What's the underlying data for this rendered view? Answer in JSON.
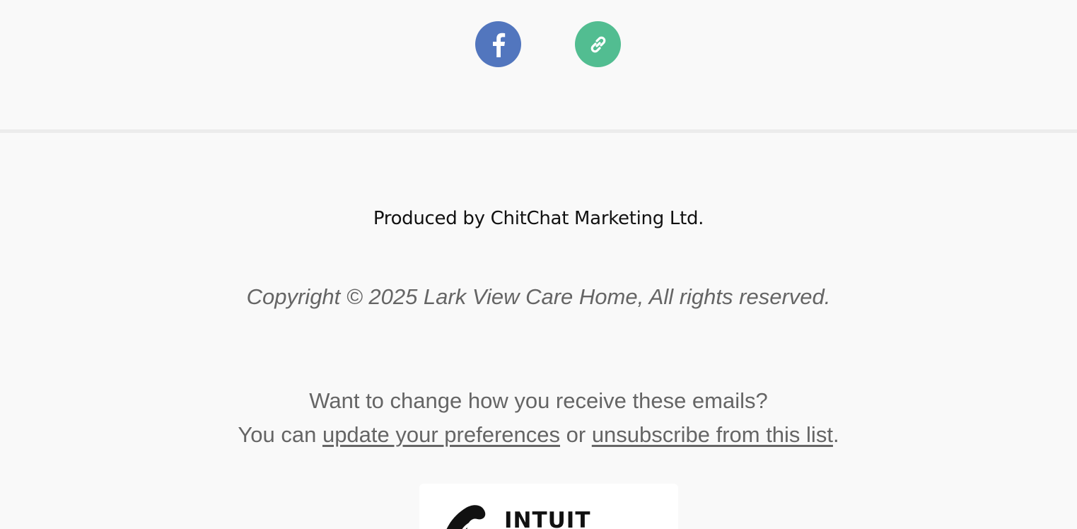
{
  "social": {
    "facebook": {
      "icon": "facebook-icon",
      "color": "#5276be"
    },
    "link": {
      "icon": "link-icon",
      "color": "#52bd91"
    }
  },
  "footer": {
    "produced_by": "Produced by ChitChat Marketing Ltd.",
    "copyright": "Copyright © 2025 Lark View Care Home, All rights reserved.",
    "prefs_line1": "Want to change how you receive these emails?",
    "prefs_prefix": "You can ",
    "update_link": "update your preferences",
    "prefs_or": " or ",
    "unsubscribe_link": "unsubscribe from this list",
    "prefs_suffix": "."
  },
  "badge": {
    "brand": "INTUIT",
    "logo_icon": "mailchimp-logo-icon"
  }
}
